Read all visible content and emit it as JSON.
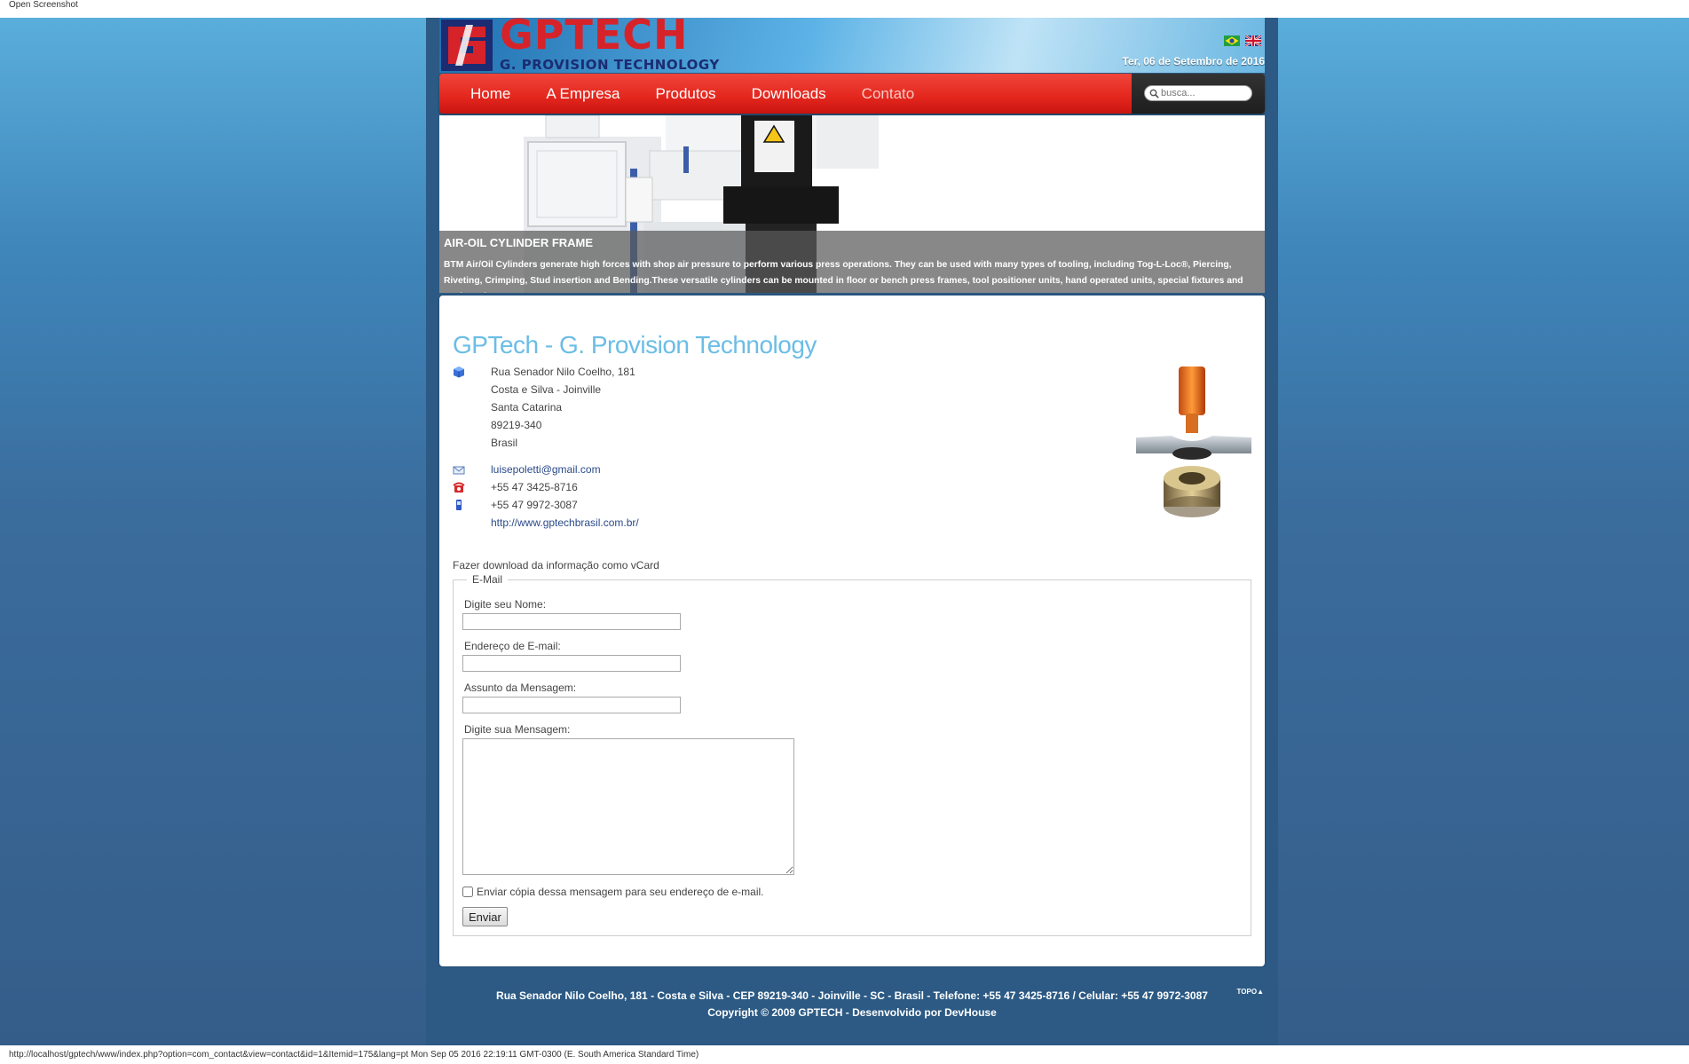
{
  "window": {
    "title": "Open Screenshot"
  },
  "status_bar": {
    "text": "http://localhost/gptech/www/index.php?option=com_contact&view=contact&id=1&Itemid=175&lang=pt Mon Sep 05 2016 22:19:11 GMT-0300 (E. South America Standard Time)"
  },
  "header": {
    "logo_title": "GPTECH",
    "logo_subtitle": "G. PROVISION TECHNOLOGY",
    "date": "Ter, 06 de Setembro de 2016",
    "languages": [
      "brazil-flag-icon",
      "uk-flag-icon"
    ]
  },
  "nav": {
    "items": [
      {
        "label": "Home"
      },
      {
        "label": "A Empresa"
      },
      {
        "label": "Produtos"
      },
      {
        "label": "Downloads"
      },
      {
        "label": "Contato"
      }
    ],
    "active": "Contato",
    "search_placeholder": "busca..."
  },
  "banner": {
    "title": "AIR-OIL CYLINDER FRAME",
    "text": "BTM Air/Oil Cylinders generate high forces with shop air pressure to perform various press operations. They can be used with many types of tooling, including Tog-L-Loc®, Piercing, Riveting, Crimping, Stud insertion and Bending.These versatile cylinders can be mounted in floor or bench press frames, tool positioner units, hand operated units, special fixtures and work station."
  },
  "contact": {
    "title": "GPTech - G. Provision Technology",
    "address": [
      "Rua Senador Nilo Coelho, 181",
      "Costa e Silva - Joinville",
      "Santa Catarina",
      "89219-340",
      "Brasil"
    ],
    "email": "luisepoletti@gmail.com",
    "phone": "+55 47 3425-8716",
    "mobile": "+55 47 9972-3087",
    "website": "http://www.gptechbrasil.com.br/",
    "vcard": "Fazer download da informação como vCard"
  },
  "form": {
    "legend": "E-Mail",
    "name_label": "Digite seu Nome:",
    "email_label": "Endereço de E-mail:",
    "subject_label": "Assunto da Mensagem:",
    "message_label": "Digite sua Mensagem:",
    "copy_label": "Enviar cópia dessa mensagem para seu endereço de e-mail.",
    "submit_label": "Enviar"
  },
  "footer": {
    "line1": "Rua Senador Nilo Coelho, 181 - Costa e Silva - CEP 89219-340 - Joinville - SC - Brasil - Telefone: +55 47 3425-8716 / Celular: +55 47 9972-3087",
    "line2": "Copyright © 2009 GPTECH - Desenvolvido por DevHouse",
    "topo": "TOPO▲"
  },
  "colors": {
    "nav_red": "#e3261d",
    "title_blue": "#6bbde5",
    "logo_red": "#d6232a",
    "logo_navy": "#1b2c72"
  }
}
